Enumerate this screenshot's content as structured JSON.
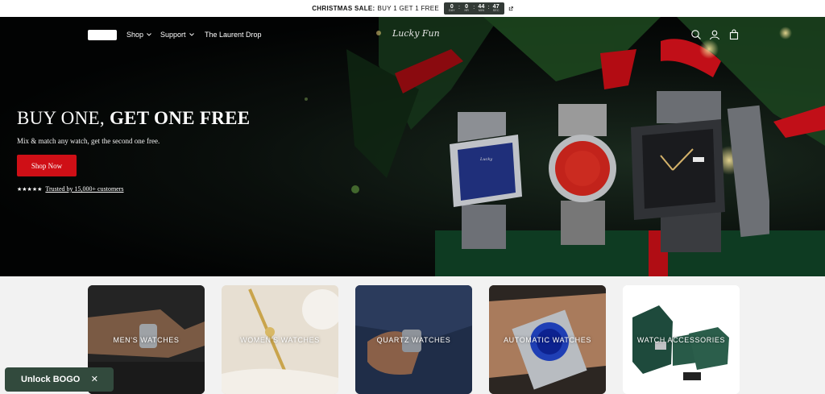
{
  "announcement": {
    "sale_bold": "CHRISTMAS SALE:",
    "sale_text": "BUY 1 GET 1 FREE",
    "countdown": [
      {
        "value": "0",
        "unit": "DAY"
      },
      {
        "value": "0",
        "unit": "HR"
      },
      {
        "value": "44",
        "unit": "MIN"
      },
      {
        "value": "47",
        "unit": "SEC"
      }
    ]
  },
  "nav": {
    "items": [
      {
        "label": "Shop",
        "dropdown": true
      },
      {
        "label": "Support",
        "dropdown": true
      },
      {
        "label": "The Laurent Drop",
        "dropdown": false
      }
    ],
    "brand": "Lucky Fun",
    "icons": [
      "search-icon",
      "account-icon",
      "cart-icon"
    ]
  },
  "hero": {
    "title_regular": "BUY ONE,",
    "title_bold": "GET ONE FREE",
    "subtitle": "Mix & match any watch, get the second one free.",
    "cta_label": "Shop Now",
    "stars": "★★★★★",
    "trust_text": "Trusted by 15,000+ customers"
  },
  "categories": [
    {
      "label": "MEN'S WATCHES"
    },
    {
      "label": "WOMEN'S WATCHES"
    },
    {
      "label": "QUARTZ WATCHES"
    },
    {
      "label": "AUTOMATIC WATCHES"
    },
    {
      "label": "WATCH ACCESSORIES"
    }
  ],
  "bogo": {
    "label": "Unlock BOGO",
    "close": "✕"
  },
  "colors": {
    "accent_red": "#cf0f16",
    "bogo_green": "#324a3d",
    "hero_dark": "#050807"
  }
}
